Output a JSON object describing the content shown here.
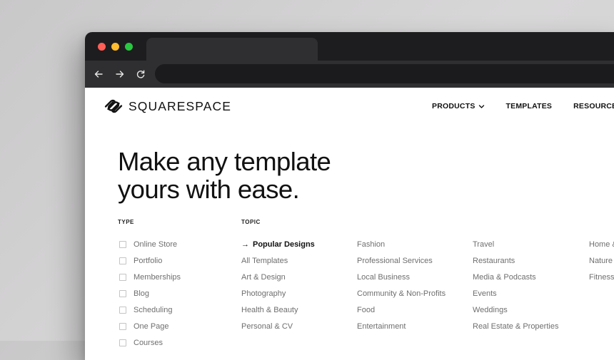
{
  "brand": {
    "name": "SQUARESPACE",
    "logo_icon": "squarespace-logo-icon"
  },
  "browser": {
    "controls": {
      "back_icon": "arrow-left-icon",
      "forward_icon": "arrow-right-icon",
      "reload_icon": "reload-icon"
    },
    "url": ""
  },
  "nav": {
    "items": [
      {
        "label": "PRODUCTS",
        "has_dropdown": true
      },
      {
        "label": "TEMPLATES",
        "has_dropdown": false
      },
      {
        "label": "RESOURCES",
        "has_dropdown": false
      }
    ]
  },
  "hero": {
    "line1": "Make any template",
    "line2": "yours with ease."
  },
  "filters": {
    "type_heading": "TYPE",
    "topic_heading": "TOPIC",
    "types": [
      "Online Store",
      "Portfolio",
      "Memberships",
      "Blog",
      "Scheduling",
      "One Page",
      "Courses"
    ],
    "topic_columns": [
      [
        "Popular Designs",
        "All Templates",
        "Art & Design",
        "Photography",
        "Health & Beauty",
        "Personal & CV"
      ],
      [
        "Fashion",
        "Professional Services",
        "Local Business",
        "Community & Non-Profits",
        "Food",
        "Entertainment"
      ],
      [
        "Travel",
        "Restaurants",
        "Media & Podcasts",
        "Events",
        "Weddings",
        "Real Estate & Properties"
      ],
      [
        "Home &",
        "Nature",
        "Fitness"
      ]
    ],
    "active_topic": "Popular Designs"
  },
  "colors": {
    "titlebar": "#1d1d1f",
    "toolbar": "#2f2f31",
    "text": "#111111",
    "muted": "#6f6f6f"
  }
}
